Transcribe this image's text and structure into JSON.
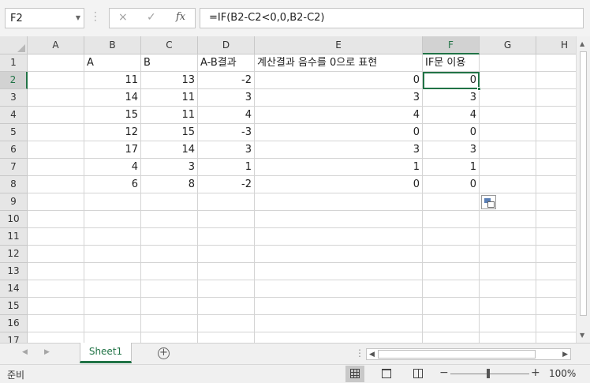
{
  "formula_bar": {
    "name_box": "F2",
    "cancel_icon": "×",
    "enter_icon": "✓",
    "fx_label": "fx",
    "formula": "=IF(B2-C2<0,0,B2-C2)"
  },
  "columns": [
    "A",
    "B",
    "C",
    "D",
    "E",
    "F",
    "G",
    "H"
  ],
  "selected_column": "F",
  "rows": [
    {
      "n": "1",
      "cells": [
        "",
        "A",
        "B",
        "A-B결과",
        "계산결과 음수를 0으로 표현",
        "IF문 이용",
        "",
        ""
      ]
    },
    {
      "n": "2",
      "cells": [
        "",
        "11",
        "13",
        "-2",
        "0",
        "0",
        "",
        ""
      ]
    },
    {
      "n": "3",
      "cells": [
        "",
        "14",
        "11",
        "3",
        "3",
        "3",
        "",
        ""
      ]
    },
    {
      "n": "4",
      "cells": [
        "",
        "15",
        "11",
        "4",
        "4",
        "4",
        "",
        ""
      ]
    },
    {
      "n": "5",
      "cells": [
        "",
        "12",
        "15",
        "-3",
        "0",
        "0",
        "",
        ""
      ]
    },
    {
      "n": "6",
      "cells": [
        "",
        "17",
        "14",
        "3",
        "3",
        "3",
        "",
        ""
      ]
    },
    {
      "n": "7",
      "cells": [
        "",
        "4",
        "3",
        "1",
        "1",
        "1",
        "",
        ""
      ]
    },
    {
      "n": "8",
      "cells": [
        "",
        "6",
        "8",
        "-2",
        "0",
        "0",
        "",
        ""
      ]
    },
    {
      "n": "9",
      "cells": [
        "",
        "",
        "",
        "",
        "",
        "",
        "",
        ""
      ]
    },
    {
      "n": "10",
      "cells": [
        "",
        "",
        "",
        "",
        "",
        "",
        "",
        ""
      ]
    },
    {
      "n": "11",
      "cells": [
        "",
        "",
        "",
        "",
        "",
        "",
        "",
        ""
      ]
    },
    {
      "n": "12",
      "cells": [
        "",
        "",
        "",
        "",
        "",
        "",
        "",
        ""
      ]
    },
    {
      "n": "13",
      "cells": [
        "",
        "",
        "",
        "",
        "",
        "",
        "",
        ""
      ]
    },
    {
      "n": "14",
      "cells": [
        "",
        "",
        "",
        "",
        "",
        "",
        "",
        ""
      ]
    },
    {
      "n": "15",
      "cells": [
        "",
        "",
        "",
        "",
        "",
        "",
        "",
        ""
      ]
    },
    {
      "n": "16",
      "cells": [
        "",
        "",
        "",
        "",
        "",
        "",
        "",
        ""
      ]
    },
    {
      "n": "17",
      "cells": [
        "",
        "",
        "",
        "",
        "",
        "",
        "",
        ""
      ]
    }
  ],
  "active_cell": {
    "row": "2",
    "column": "F"
  },
  "sheet_tabs": {
    "active": "Sheet1"
  },
  "status_bar": {
    "ready": "준비",
    "zoom": "100%",
    "zoom_minus": "−",
    "zoom_plus": "+"
  },
  "colors": {
    "accent": "#217346"
  }
}
